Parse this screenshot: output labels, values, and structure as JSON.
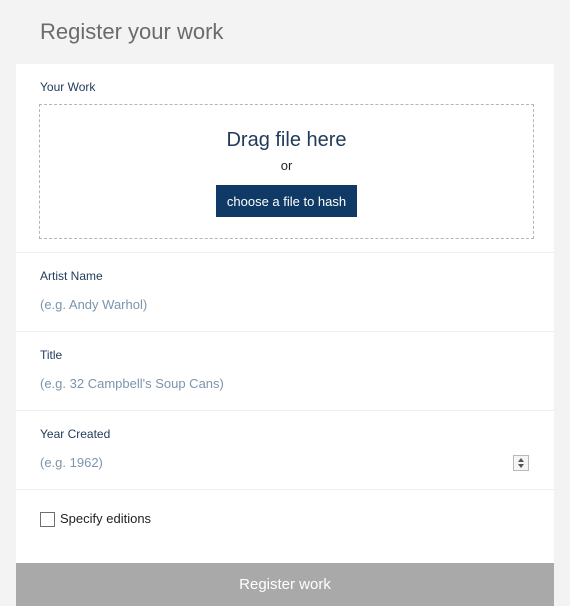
{
  "page": {
    "title": "Register your work"
  },
  "work": {
    "label": "Your Work",
    "drop_title": "Drag file here",
    "drop_or": "or",
    "choose_button": "choose a file to hash"
  },
  "artist": {
    "label": "Artist Name",
    "placeholder": "(e.g. Andy Warhol)",
    "value": ""
  },
  "title_field": {
    "label": "Title",
    "placeholder": "(e.g. 32 Campbell's Soup Cans)",
    "value": ""
  },
  "year": {
    "label": "Year Created",
    "placeholder": "(e.g. 1962)",
    "value": ""
  },
  "editions": {
    "label": "Specify editions",
    "checked": false
  },
  "submit": {
    "label": "Register work"
  },
  "colors": {
    "primary": "#0f3a66",
    "label_text": "#1f3a5a",
    "placeholder_text": "#7c95ab",
    "disabled_button": "#a9a9a9",
    "page_background": "#f3f3f3"
  }
}
